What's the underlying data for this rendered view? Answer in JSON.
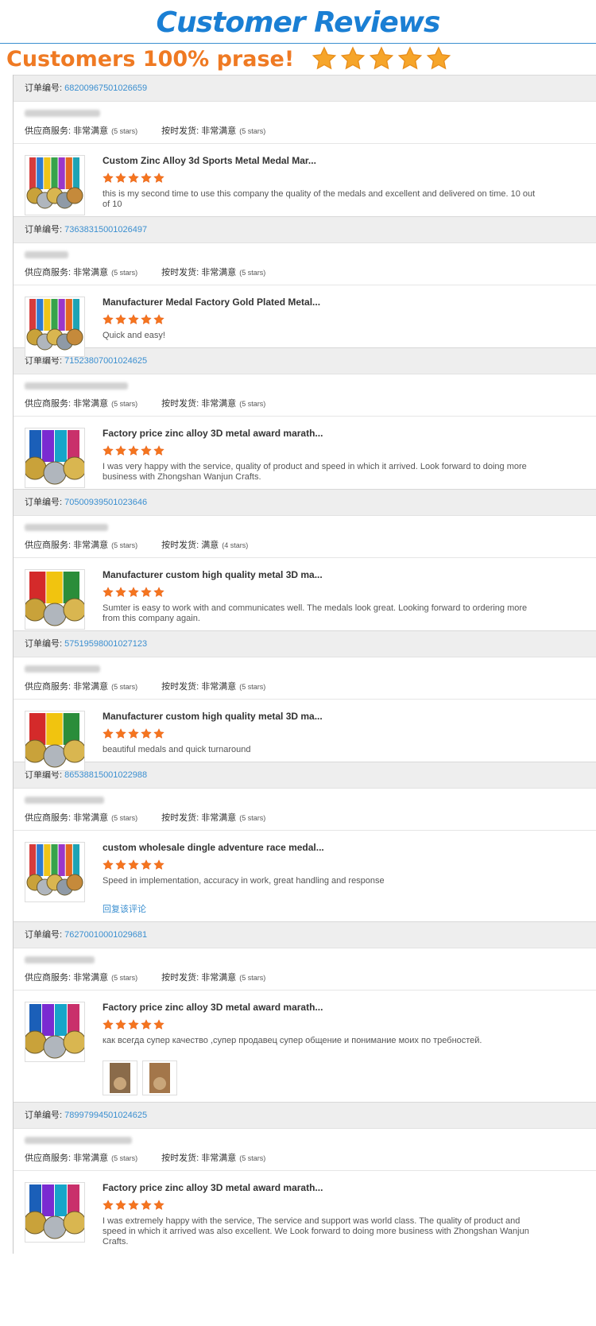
{
  "page": {
    "title": "Customer Reviews",
    "praise": "Customers 100% prase!"
  },
  "colors": {
    "accent": "#1a7fd4",
    "orange": "#ef7a23",
    "star": "#f5901e"
  },
  "orders": [
    {
      "label": "订单编号:",
      "number": "68200967501026659",
      "supplier_label": "供应商服务:",
      "supplier_value": "非常满意",
      "supplier_stars": "(5 stars)",
      "ship_label": "按时发货:",
      "ship_value": "非常满意",
      "ship_stars": "(5 stars)",
      "title": "Custom Zinc Alloy 3d Sports Metal Medal Mar...",
      "rating": 5,
      "comment": "this is my second time to use this company the quality of the medals and excellent and delivered on time. 10 out of 10",
      "image": "medals-colorful-icon"
    },
    {
      "label": "订单编号:",
      "number": "73638315001026497",
      "supplier_label": "供应商服务:",
      "supplier_value": "非常满意",
      "supplier_stars": "(5 stars)",
      "ship_label": "按时发货:",
      "ship_value": "非常满意",
      "ship_stars": "(5 stars)",
      "title": "Manufacturer Medal Factory Gold Plated Metal...",
      "rating": 5,
      "comment": "Quick and easy!",
      "image": "medals-colorful-icon"
    },
    {
      "label": "订单编号:",
      "number": "71523807001024625",
      "supplier_label": "供应商服务:",
      "supplier_value": "非常满意",
      "supplier_stars": "(5 stars)",
      "ship_label": "按时发货:",
      "ship_value": "非常满意",
      "ship_stars": "(5 stars)",
      "title": "Factory price zinc alloy 3D metal award marath...",
      "rating": 5,
      "comment": "I was very happy with the service, quality of product and speed in which it arrived. Look forward to doing more business with Zhongshan Wanjun Crafts.",
      "image": "medals-blue-icon"
    },
    {
      "label": "订单编号:",
      "number": "70500939501023646",
      "supplier_label": "供应商服务:",
      "supplier_value": "非常满意",
      "supplier_stars": "(5 stars)",
      "ship_label": "按时发货:",
      "ship_value": "满意",
      "ship_stars": "(4 stars)",
      "title": "Manufacturer custom high quality metal 3D ma...",
      "rating": 5,
      "comment": "Sumter is easy to work with and communicates well. The medals look great. Looking forward to ordering more from this company again.",
      "image": "medals-ribbon-icon"
    },
    {
      "label": "订单编号:",
      "number": "57519598001027123",
      "supplier_label": "供应商服务:",
      "supplier_value": "非常满意",
      "supplier_stars": "(5 stars)",
      "ship_label": "按时发货:",
      "ship_value": "非常满意",
      "ship_stars": "(5 stars)",
      "title": "Manufacturer custom high quality metal 3D ma...",
      "rating": 5,
      "comment": "beautiful medals and quick turnaround",
      "image": "medals-ribbon-icon"
    },
    {
      "label": "订单编号:",
      "number": "86538815001022988",
      "supplier_label": "供应商服务:",
      "supplier_value": "非常满意",
      "supplier_stars": "(5 stars)",
      "ship_label": "按时发货:",
      "ship_value": "非常满意",
      "ship_stars": "(5 stars)",
      "title": "custom wholesale dingle adventure race medal...",
      "rating": 5,
      "comment": "Speed in implementation, accuracy in work, great handling and response",
      "reply": "回复该评论",
      "image": "medals-colorful-icon"
    },
    {
      "label": "订单编号:",
      "number": "76270010001029681",
      "supplier_label": "供应商服务:",
      "supplier_value": "非常满意",
      "supplier_stars": "(5 stars)",
      "ship_label": "按时发货:",
      "ship_value": "非常满意",
      "ship_stars": "(5 stars)",
      "title": "Factory price zinc alloy 3D metal award marath...",
      "rating": 5,
      "comment": "как всегда супер качество ,супер продавец супер общение и понимание моих по требностей.",
      "photos": 2,
      "image": "medals-blue-icon"
    },
    {
      "label": "订单编号:",
      "number": "78997994501024625",
      "supplier_label": "供应商服务:",
      "supplier_value": "非常满意",
      "supplier_stars": "(5 stars)",
      "ship_label": "按时发货:",
      "ship_value": "非常满意",
      "ship_stars": "(5 stars)",
      "title": "Factory price zinc alloy 3D metal award marath...",
      "rating": 5,
      "comment": "I was extremely happy with the service, The service and support was world class. The quality of product and speed in which it arrived was also excellent. We Look forward to doing more business with Zhongshan Wanjun Crafts.",
      "image": "medals-blue-icon"
    }
  ]
}
